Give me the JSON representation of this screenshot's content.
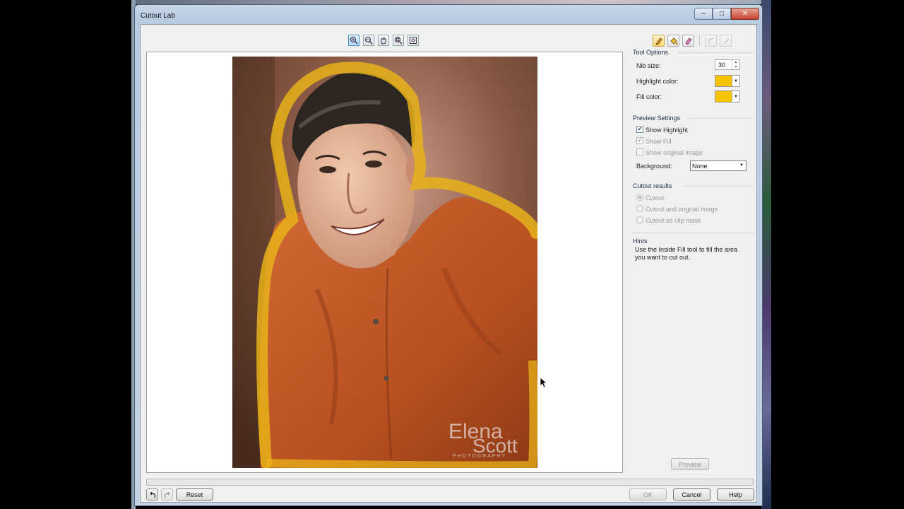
{
  "window": {
    "title": "Cutout Lab",
    "buttons": {
      "minimize": "–",
      "maximize": "□",
      "close": "✕"
    }
  },
  "canvas_toolbar": {
    "tools": [
      "zoom-in-icon",
      "zoom-out-icon",
      "pan-hand-icon",
      "zoom-one-to-one-icon",
      "zoom-to-fit-icon"
    ]
  },
  "photo": {
    "watermark_line1": "Elena",
    "watermark_line2": "Scott",
    "watermark_line3": "PHOTOGRAPHY",
    "highlight_color": "#e8b21a"
  },
  "right_toolbar": {
    "tools": [
      "highlighter-icon",
      "inside-fill-icon",
      "eraser-icon",
      "auto-reduce-icon",
      "detail-remove-icon"
    ]
  },
  "tool_options": {
    "title": "Tool Options",
    "nib_size_label": "Nib size:",
    "nib_size_value": "30",
    "highlight_color_label": "Highlight color:",
    "highlight_color": "#f5c400",
    "fill_color_label": "Fill color:",
    "fill_color": "#f5c400"
  },
  "preview_settings": {
    "title": "Preview Settings",
    "show_highlight": "Show Highlight",
    "show_fill": "Show Fill",
    "show_original": "Show original image",
    "background_label": "Background:",
    "background_value": "None"
  },
  "cutout_results": {
    "title": "Cutout results",
    "options": [
      "Cutout",
      "Cutout and original image",
      "Cutout as clip mask"
    ]
  },
  "hints": {
    "title": "Hints",
    "text": "Use the Inside Fill tool to fill the area you want to cut out."
  },
  "buttons": {
    "preview": "Preview",
    "reset": "Reset",
    "ok": "OK",
    "cancel": "Cancel",
    "help": "Help"
  }
}
